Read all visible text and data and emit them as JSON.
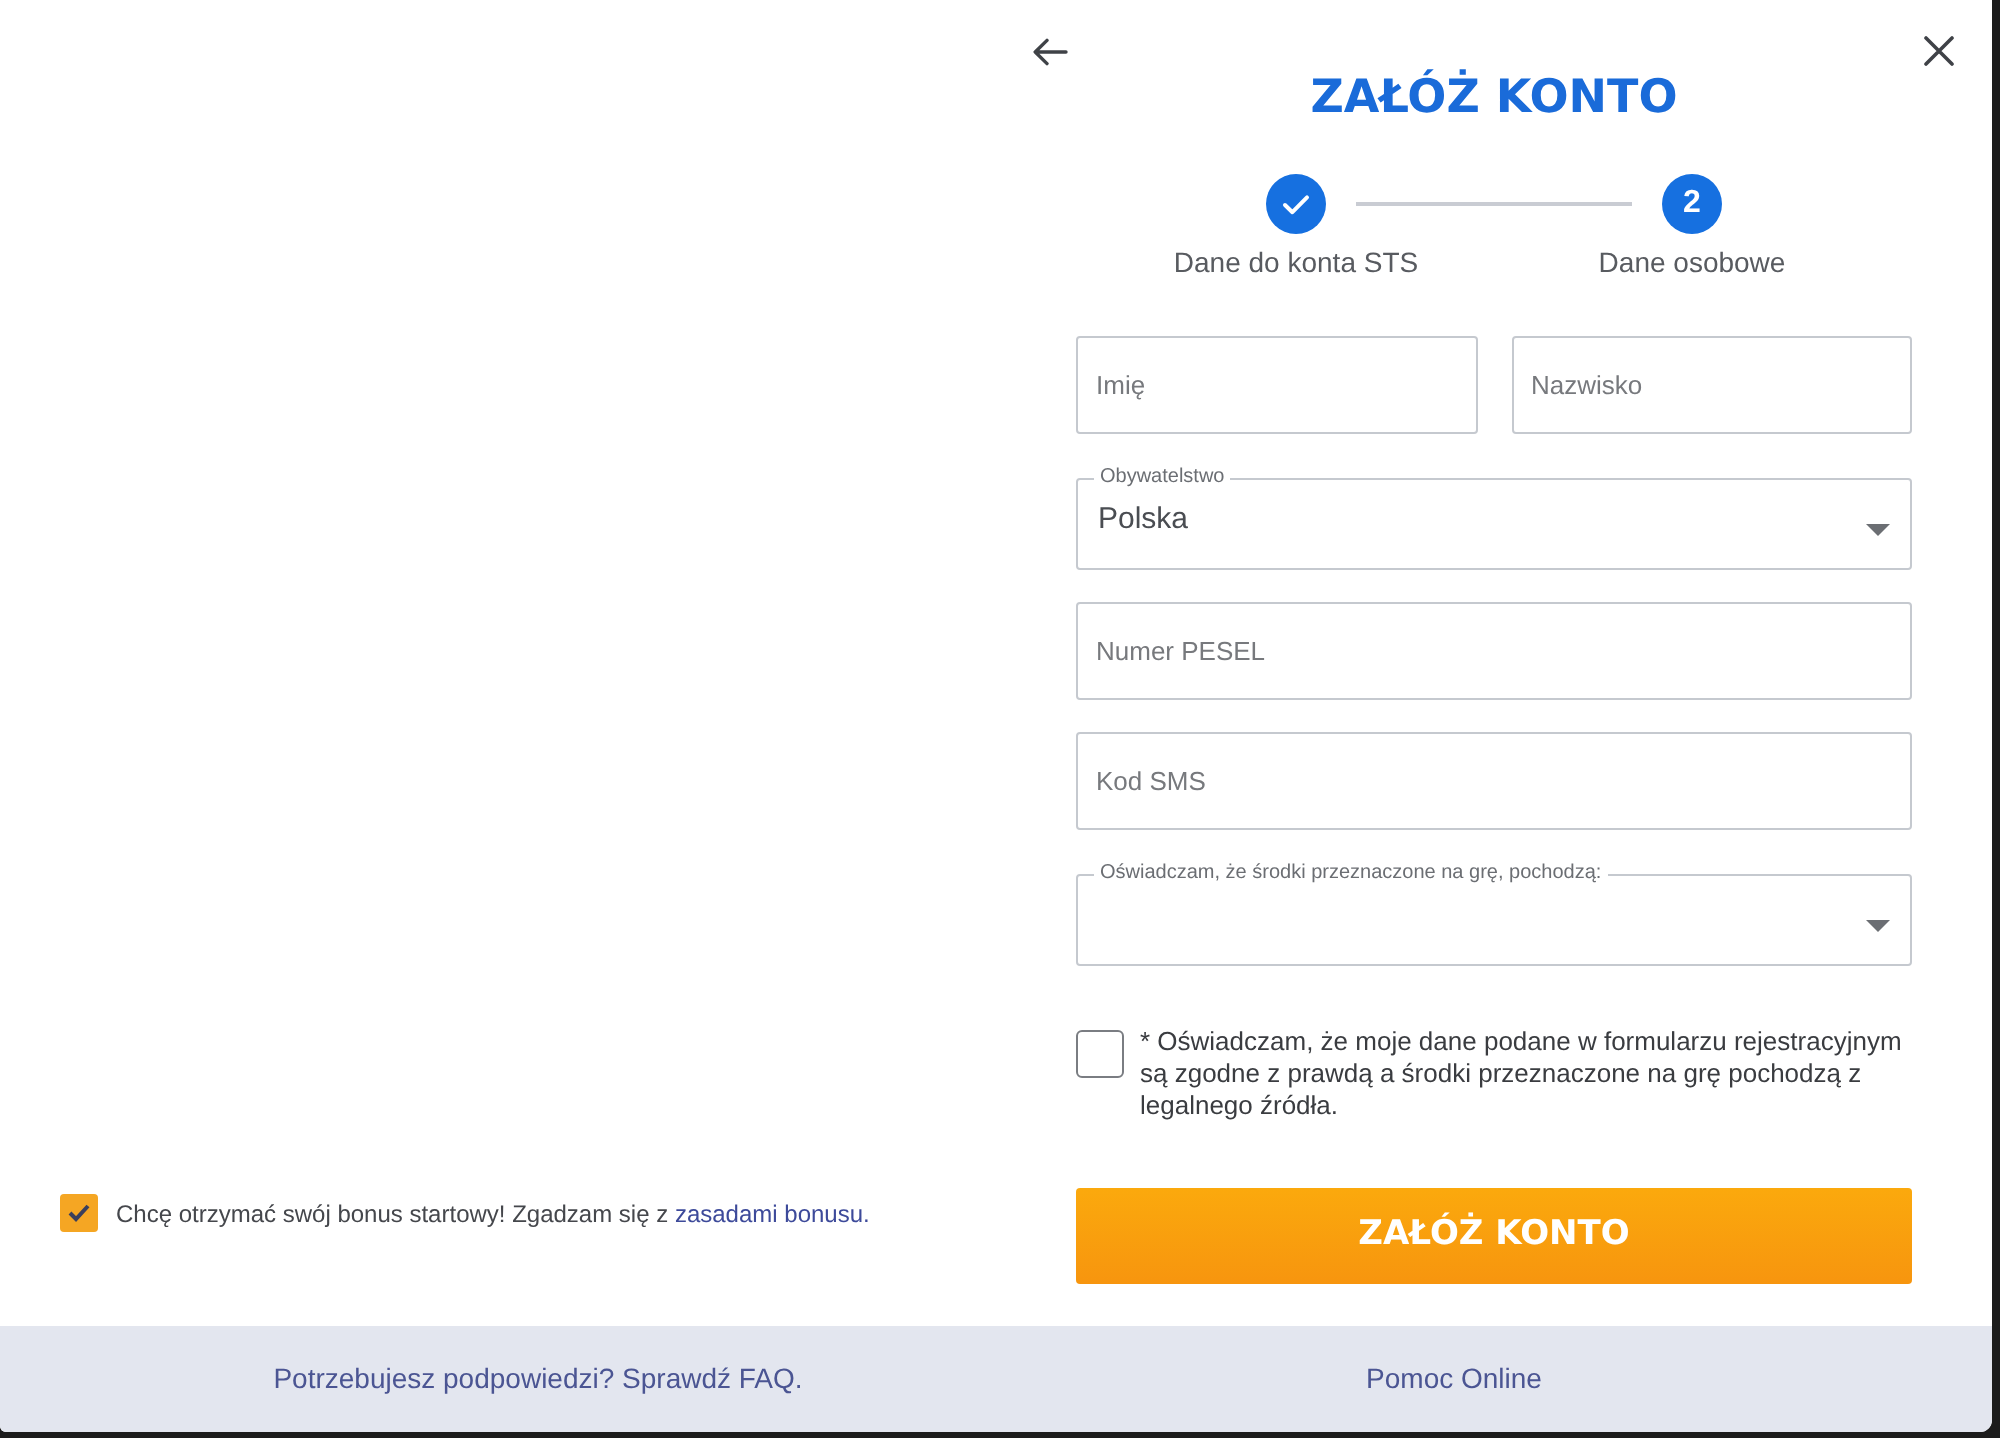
{
  "header": {
    "title": "ZAŁÓŻ KONTO"
  },
  "steps": [
    {
      "label": "Dane do konta STS",
      "completed": true
    },
    {
      "number": "2",
      "label": "Dane osobowe",
      "completed": false
    }
  ],
  "form": {
    "rows": [
      {
        "fields": [
          {
            "kind": "text",
            "placeholder": "Imię"
          },
          {
            "kind": "text",
            "placeholder": "Nazwisko"
          }
        ]
      },
      {
        "fields": [
          {
            "kind": "select",
            "label": "Obywatelstwo",
            "value": "Polska"
          }
        ]
      },
      {
        "fields": [
          {
            "kind": "text",
            "placeholder": "Numer PESEL"
          }
        ]
      },
      {
        "fields": [
          {
            "kind": "text",
            "placeholder": "Kod SMS"
          }
        ]
      },
      {
        "fields": [
          {
            "kind": "select",
            "label": "Oświadczam, że środki przeznaczone na grę, pochodzą:"
          }
        ]
      }
    ]
  },
  "declaration": {
    "checked": false,
    "text": "* Oświadczam, że moje dane podane w formularzu rejestracyjnym są zgodne z prawdą a środki przeznaczone na grę pochodzą z legalnego źródła."
  },
  "submit_button": {
    "label": "ZAŁÓŻ KONTO"
  },
  "bonus": {
    "checked": true,
    "text": "Chcę otrzymać swój bonus startowy! Zgadzam się z",
    "link": "zasadami bonusu."
  },
  "footer": {
    "links": [
      "Potrzebujesz podpowiedzi? Sprawdź FAQ.",
      "Pomoc Online"
    ]
  }
}
